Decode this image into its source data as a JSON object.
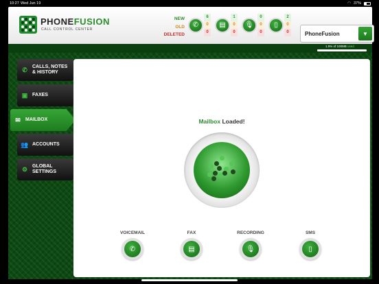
{
  "status_bar": {
    "time": "10:27",
    "date": "Wed Jun 19",
    "battery": "37%"
  },
  "header": {
    "brand_phone": "PHONE",
    "brand_fusion": "FUSION",
    "subtitle": "CALL CONTROL CENTER",
    "stat_labels": {
      "new": "NEW",
      "old": "OLD",
      "deleted": "DELETED"
    },
    "stats": [
      {
        "icon": "phone-icon",
        "glyph": "✆",
        "new": "6",
        "old": "0",
        "deleted": "0"
      },
      {
        "icon": "document-icon",
        "glyph": "▤",
        "new": "1",
        "old": "0",
        "deleted": "0"
      },
      {
        "icon": "microphone-icon",
        "glyph": "🎙",
        "new": "0",
        "old": "0",
        "deleted": "0"
      },
      {
        "icon": "mobile-icon",
        "glyph": "▯",
        "new": "2",
        "old": "0",
        "deleted": "0"
      }
    ],
    "account": {
      "name": "PhoneFusion",
      "arrow": "▼"
    }
  },
  "storage": {
    "text": "1.9% of 100MB",
    "suffix": "used",
    "percent": 1.9
  },
  "sidebar": {
    "items": [
      {
        "id": "calls",
        "icon": "phone-icon",
        "glyph": "✆",
        "line1": "CALLS, NOTES",
        "line2": "& HISTORY",
        "active": false
      },
      {
        "id": "faxes",
        "icon": "fax-icon",
        "glyph": "▣",
        "line1": "FAXES",
        "line2": "",
        "active": false
      },
      {
        "id": "mailbox",
        "icon": "envelope-icon",
        "glyph": "✉",
        "line1": "MAILBOX",
        "line2": "",
        "active": true
      },
      {
        "id": "accounts",
        "icon": "users-icon",
        "glyph": "👥",
        "line1": "ACCOUNTS",
        "line2": "",
        "active": false
      },
      {
        "id": "settings",
        "icon": "gear-icon",
        "glyph": "⚙",
        "line1": "GLOBAL",
        "line2": "SETTINGS",
        "active": false
      }
    ]
  },
  "main": {
    "status_word": "Mailbox",
    "status_rest": " Loaded!",
    "tiles": [
      {
        "label": "VOICEMAIL",
        "icon": "phone-icon",
        "glyph": "✆"
      },
      {
        "label": "FAX",
        "icon": "document-icon",
        "glyph": "▤"
      },
      {
        "label": "RECORDING",
        "icon": "microphone-icon",
        "glyph": "🎙"
      },
      {
        "label": "SMS",
        "icon": "mobile-icon",
        "glyph": "▯"
      }
    ]
  },
  "colors": {
    "accent": "#2e8b2e",
    "old": "#d38a1a",
    "deleted": "#c62828",
    "background": "#0d4a12"
  }
}
